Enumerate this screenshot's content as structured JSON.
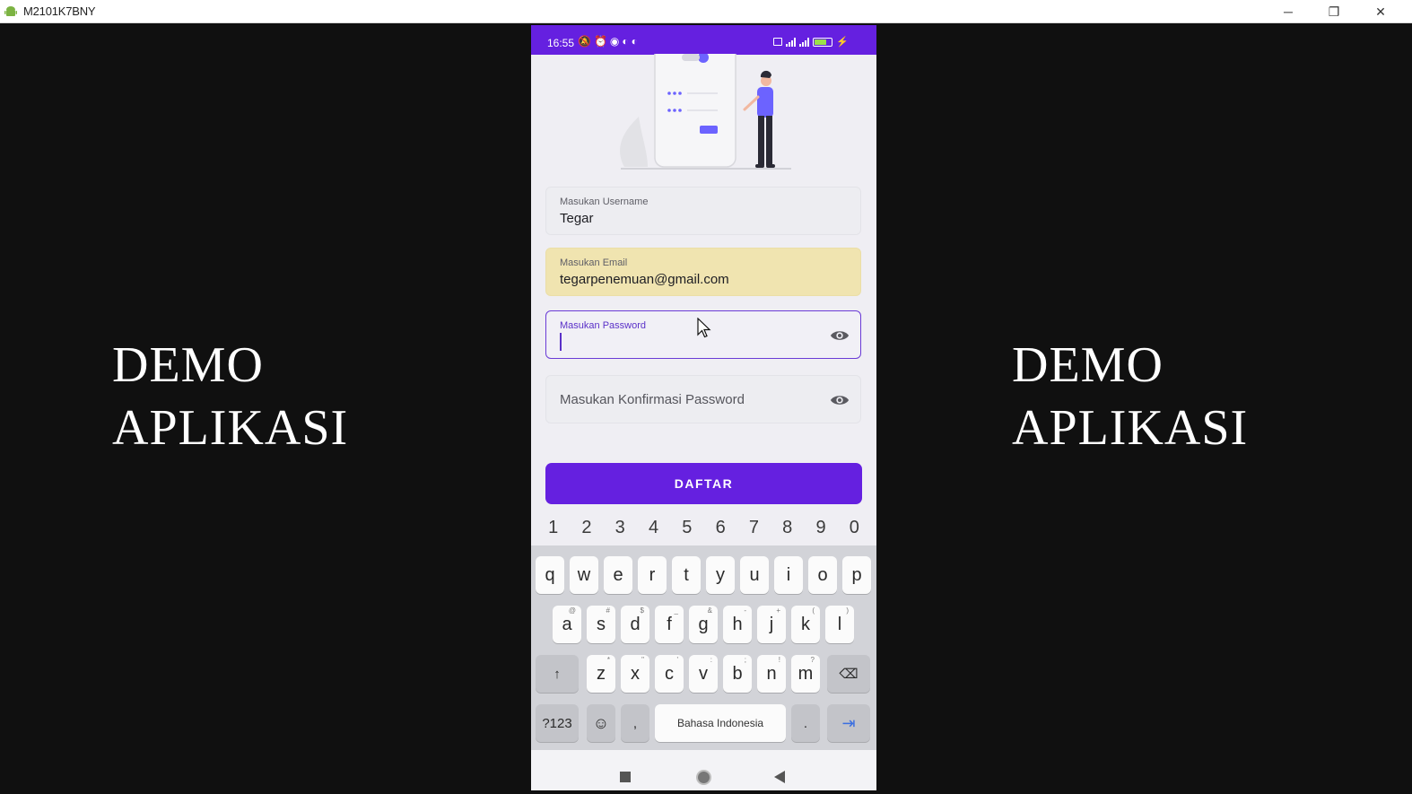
{
  "window": {
    "title": "M2101K7BNY",
    "min_glyph": "─",
    "restore_glyph": "❐",
    "close_glyph": "✕"
  },
  "captions": {
    "left": [
      "DEMO",
      "APLIKASI"
    ],
    "right": [
      "DEMO",
      "APLIKASI"
    ]
  },
  "phone": {
    "status": {
      "time": "16:55",
      "battery_label": "71"
    },
    "form": {
      "username": {
        "label": "Masukan Username",
        "value": "Tegar"
      },
      "email": {
        "label": "Masukan Email",
        "value": "tegarpenemuan@gmail.com"
      },
      "password": {
        "label": "Masukan Password",
        "value": ""
      },
      "confirm_password": {
        "placeholder": "Masukan Konfirmasi Password"
      },
      "submit_label": "DAFTAR"
    },
    "keyboard": {
      "numbers": [
        "1",
        "2",
        "3",
        "4",
        "5",
        "6",
        "7",
        "8",
        "9",
        "0"
      ],
      "row1": [
        "q",
        "w",
        "e",
        "r",
        "t",
        "y",
        "u",
        "i",
        "o",
        "p"
      ],
      "row2": [
        "a",
        "s",
        "d",
        "f",
        "g",
        "h",
        "j",
        "k",
        "l"
      ],
      "row2_sub": [
        "@",
        "#",
        "$",
        "_",
        "&",
        "-",
        "+",
        "(",
        ")"
      ],
      "row3": [
        "z",
        "x",
        "c",
        "v",
        "b",
        "n",
        "m"
      ],
      "row3_sub": [
        "*",
        "\"",
        "'",
        ":",
        ";",
        "!",
        "?"
      ],
      "shift": "↑",
      "backspace": "⌫",
      "symbols": "?123",
      "emoji": "☺",
      "comma": ",",
      "space": "Bahasa Indonesia",
      "period": ".",
      "enter": "⇥"
    }
  },
  "colors": {
    "primary": "#6520e0",
    "autofill": "#f0e4b0"
  }
}
